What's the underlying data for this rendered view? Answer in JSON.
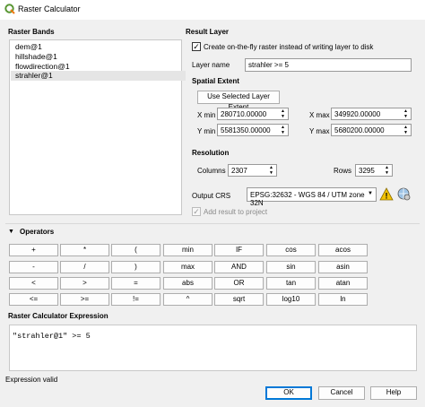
{
  "window": {
    "title": "Raster Calculator"
  },
  "raster_bands": {
    "heading": "Raster Bands",
    "items": [
      "dem@1",
      "hillshade@1",
      "flowdirection@1",
      "strahler@1"
    ],
    "selected_index": 3
  },
  "result_layer": {
    "heading": "Result Layer",
    "on_the_fly_label": "Create on-the-fly raster instead of writing layer to disk",
    "on_the_fly_checked": true,
    "layer_name_label": "Layer name",
    "layer_name_value": "strahler >= 5"
  },
  "spatial_extent": {
    "heading": "Spatial Extent",
    "use_selected_button": "Use Selected Layer Extent",
    "xmin_label": "X min",
    "xmin_value": "280710.00000",
    "xmax_label": "X max",
    "xmax_value": "349920.00000",
    "ymin_label": "Y min",
    "ymin_value": "5581350.00000",
    "ymax_label": "Y max",
    "ymax_value": "5680200.00000"
  },
  "resolution": {
    "heading": "Resolution",
    "columns_label": "Columns",
    "columns_value": "2307",
    "rows_label": "Rows",
    "rows_value": "3295",
    "output_crs_label": "Output CRS",
    "output_crs_value": "EPSG:32632 - WGS 84 / UTM zone 32N",
    "add_result_label": "Add result to project",
    "add_result_checked": true
  },
  "operators": {
    "heading": "Operators",
    "rows": [
      [
        "+",
        "*",
        "(",
        "min",
        "IF",
        "cos",
        "acos"
      ],
      [
        "-",
        "/",
        ")",
        "max",
        "AND",
        "sin",
        "asin"
      ],
      [
        "<",
        ">",
        "=",
        "abs",
        "OR",
        "tan",
        "atan"
      ],
      [
        "<=",
        ">=",
        "!=",
        "^",
        "sqrt",
        "log10",
        "ln"
      ]
    ]
  },
  "expression": {
    "heading": "Raster Calculator Expression",
    "text": "\"strahler@1\" >= 5"
  },
  "status": {
    "text": "Expression valid"
  },
  "buttons": {
    "ok": "OK",
    "cancel": "Cancel",
    "help": "Help"
  },
  "colors": {
    "accent": "#0078d7",
    "qgis_green": "#589632",
    "warning": "#f2c200"
  }
}
